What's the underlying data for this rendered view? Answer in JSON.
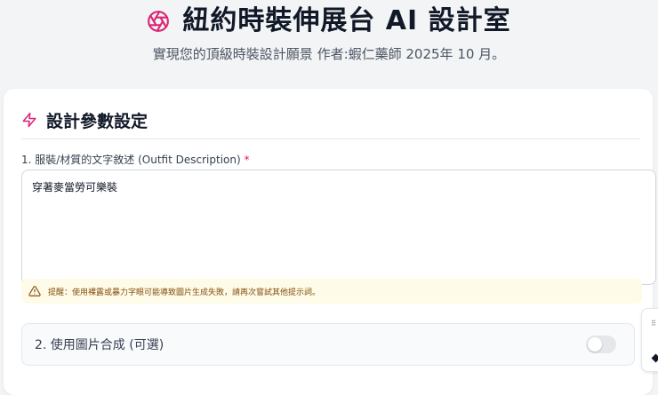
{
  "header": {
    "title": "紐約時裝伸展台 AI 設計室",
    "subtitle": "實現您的頂級時裝設計願景 作者:蝦仁藥師 2025年 10 月。",
    "accent_color": "#db2777"
  },
  "section": {
    "title": "設計參數設定",
    "icon": "lightning-icon"
  },
  "description_field": {
    "label": "1. 服裝/材質的文字敘述 (Outfit Description)",
    "required_mark": "*",
    "value": "穿著麥當勞可樂裝"
  },
  "warning": {
    "text": "提醒：使用裸露或暴力字眼可能導致圖片生成失敗，請再次嘗試其他提示詞。",
    "color": "#854d0e"
  },
  "image_compose": {
    "label": "2. 使用圖片合成 (可選)",
    "enabled": false
  },
  "side_widget": {
    "dots": "⠿"
  }
}
